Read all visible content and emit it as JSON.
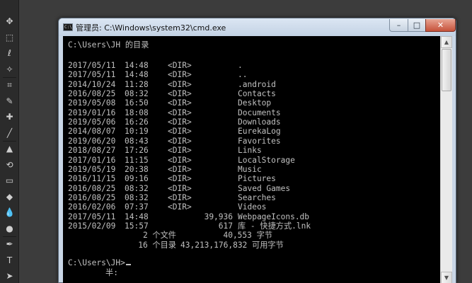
{
  "window": {
    "title": "管理员: C:\\Windows\\system32\\cmd.exe",
    "icon_label": "C:\\",
    "controls": {
      "minimize": "–",
      "maximize": "□",
      "close": "✕"
    }
  },
  "console": {
    "header": "C:\\Users\\JH 的目录",
    "entries": [
      {
        "date": "2017/05/11",
        "time": "14:48",
        "type": "<DIR>",
        "size": "",
        "name": "."
      },
      {
        "date": "2017/05/11",
        "time": "14:48",
        "type": "<DIR>",
        "size": "",
        "name": ".."
      },
      {
        "date": "2014/10/24",
        "time": "11:28",
        "type": "<DIR>",
        "size": "",
        "name": ".android"
      },
      {
        "date": "2016/08/25",
        "time": "08:32",
        "type": "<DIR>",
        "size": "",
        "name": "Contacts"
      },
      {
        "date": "2019/05/08",
        "time": "16:50",
        "type": "<DIR>",
        "size": "",
        "name": "Desktop"
      },
      {
        "date": "2019/01/16",
        "time": "18:08",
        "type": "<DIR>",
        "size": "",
        "name": "Documents"
      },
      {
        "date": "2019/05/06",
        "time": "16:26",
        "type": "<DIR>",
        "size": "",
        "name": "Downloads"
      },
      {
        "date": "2014/08/07",
        "time": "10:19",
        "type": "<DIR>",
        "size": "",
        "name": "EurekaLog"
      },
      {
        "date": "2019/06/20",
        "time": "08:43",
        "type": "<DIR>",
        "size": "",
        "name": "Favorites"
      },
      {
        "date": "2018/08/27",
        "time": "17:26",
        "type": "<DIR>",
        "size": "",
        "name": "Links"
      },
      {
        "date": "2017/01/16",
        "time": "11:15",
        "type": "<DIR>",
        "size": "",
        "name": "LocalStorage"
      },
      {
        "date": "2019/05/19",
        "time": "20:38",
        "type": "<DIR>",
        "size": "",
        "name": "Music"
      },
      {
        "date": "2016/11/15",
        "time": "09:16",
        "type": "<DIR>",
        "size": "",
        "name": "Pictures"
      },
      {
        "date": "2016/08/25",
        "time": "08:32",
        "type": "<DIR>",
        "size": "",
        "name": "Saved Games"
      },
      {
        "date": "2016/08/25",
        "time": "08:32",
        "type": "<DIR>",
        "size": "",
        "name": "Searches"
      },
      {
        "date": "2016/02/06",
        "time": "07:37",
        "type": "<DIR>",
        "size": "",
        "name": "Videos"
      },
      {
        "date": "2017/05/11",
        "time": "14:48",
        "type": "",
        "size": "39,936",
        "name": "WebpageIcons.db"
      },
      {
        "date": "2015/02/09",
        "time": "15:57",
        "type": "",
        "size": "617",
        "name": "库 - 快捷方式.lnk"
      }
    ],
    "summary_files": "2 个文件",
    "summary_files_bytes": "40,553 字节",
    "summary_dirs": "16 个目录",
    "summary_dirs_bytes": "43,213,176,832 可用字节",
    "prompt": "C:\\Users\\JH>",
    "ime_indicator": "半:"
  },
  "toolbar": {
    "tools": [
      "move-icon",
      "marquee-icon",
      "lasso-icon",
      "magic-wand-icon",
      "crop-icon",
      "eyedropper-icon",
      "healing-brush-icon",
      "brush-icon",
      "clone-stamp-icon",
      "history-brush-icon",
      "eraser-icon",
      "paint-bucket-icon",
      "blur-icon",
      "dodge-icon",
      "pen-icon",
      "type-icon",
      "path-selection-icon"
    ],
    "glyphs": [
      "✥",
      "⬚",
      "ℓ",
      "✧",
      "⌗",
      "✎",
      "✚",
      "╱",
      "▲",
      "⟲",
      "▭",
      "◆",
      "💧",
      "●",
      "✒",
      "T",
      "➤"
    ]
  },
  "scrollbar": {
    "up": "▲",
    "down": "▼"
  }
}
